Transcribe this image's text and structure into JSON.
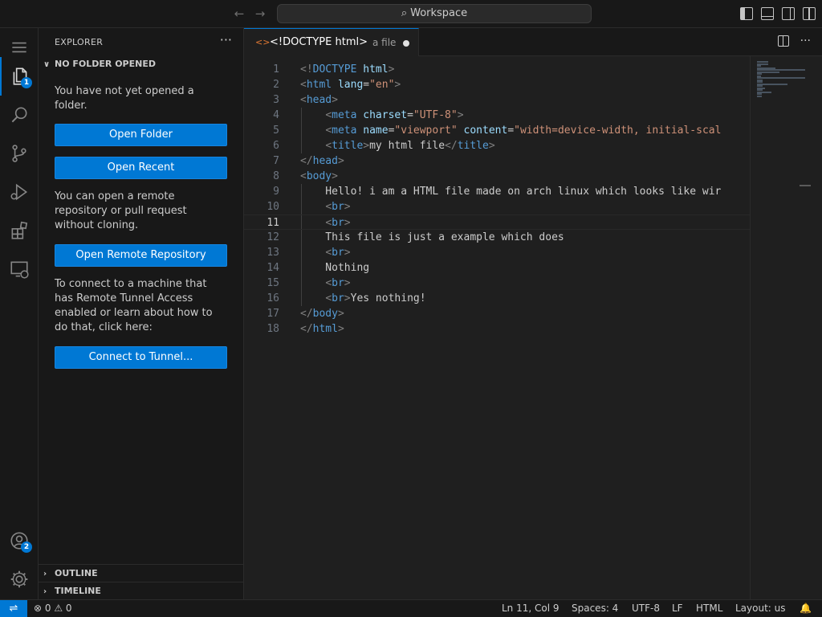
{
  "titlebar": {
    "back_icon": "arrow-left-icon",
    "forward_icon": "arrow-right-icon",
    "search_text": "Workspace"
  },
  "activity": {
    "explorer_badge": "1",
    "accounts_badge": "2"
  },
  "sidebar": {
    "title": "EXPLORER",
    "more": "···",
    "section_title": "NO FOLDER OPENED",
    "text1": "You have not yet opened a folder.",
    "btn_open_folder": "Open Folder",
    "btn_open_recent": "Open Recent",
    "text2": "You can open a remote repository or pull request without cloning.",
    "btn_open_remote": "Open Remote Repository",
    "text3": "To connect to a machine that has Remote Tunnel Access enabled or learn about how to do that, click here:",
    "btn_tunnel": "Connect to Tunnel...",
    "outline": "OUTLINE",
    "timeline": "TIMELINE"
  },
  "editor": {
    "tab_icon": "<>",
    "tab_name": "<!DOCTYPE html>",
    "tab_desc": "a file",
    "lines": [
      {
        "n": "1",
        "tokens": [
          [
            "br",
            "<!"
          ],
          [
            "tag",
            "DOCTYPE"
          ],
          [
            "txt",
            " "
          ],
          [
            "attr",
            "html"
          ],
          [
            "br",
            ">"
          ]
        ]
      },
      {
        "n": "2",
        "tokens": [
          [
            "br",
            "<"
          ],
          [
            "tag",
            "html"
          ],
          [
            "txt",
            " "
          ],
          [
            "attr",
            "lang"
          ],
          [
            "txt",
            "="
          ],
          [
            "str",
            "\"en\""
          ],
          [
            "br",
            ">"
          ]
        ]
      },
      {
        "n": "3",
        "tokens": [
          [
            "br",
            "<"
          ],
          [
            "tag",
            "head"
          ],
          [
            "br",
            ">"
          ]
        ]
      },
      {
        "n": "4",
        "tokens": [
          [
            "txt",
            "    "
          ],
          [
            "br",
            "<"
          ],
          [
            "tag",
            "meta"
          ],
          [
            "txt",
            " "
          ],
          [
            "attr",
            "charset"
          ],
          [
            "txt",
            "="
          ],
          [
            "str",
            "\"UTF-8\""
          ],
          [
            "br",
            ">"
          ]
        ]
      },
      {
        "n": "5",
        "tokens": [
          [
            "txt",
            "    "
          ],
          [
            "br",
            "<"
          ],
          [
            "tag",
            "meta"
          ],
          [
            "txt",
            " "
          ],
          [
            "attr",
            "name"
          ],
          [
            "txt",
            "="
          ],
          [
            "str",
            "\"viewport\""
          ],
          [
            "txt",
            " "
          ],
          [
            "attr",
            "content"
          ],
          [
            "txt",
            "="
          ],
          [
            "str",
            "\"width=device-width, initial-scal"
          ]
        ]
      },
      {
        "n": "6",
        "tokens": [
          [
            "txt",
            "    "
          ],
          [
            "br",
            "<"
          ],
          [
            "tag",
            "title"
          ],
          [
            "br",
            ">"
          ],
          [
            "txt",
            "my html file"
          ],
          [
            "br",
            "</"
          ],
          [
            "tag",
            "title"
          ],
          [
            "br",
            ">"
          ]
        ]
      },
      {
        "n": "7",
        "tokens": [
          [
            "br",
            "</"
          ],
          [
            "tag",
            "head"
          ],
          [
            "br",
            ">"
          ]
        ]
      },
      {
        "n": "8",
        "tokens": [
          [
            "br",
            "<"
          ],
          [
            "tag",
            "body"
          ],
          [
            "br",
            ">"
          ]
        ]
      },
      {
        "n": "9",
        "tokens": [
          [
            "txt",
            "    Hello! i am a HTML file made on arch linux which looks like wir"
          ]
        ]
      },
      {
        "n": "10",
        "tokens": [
          [
            "txt",
            "    "
          ],
          [
            "br",
            "<"
          ],
          [
            "tag",
            "br"
          ],
          [
            "br",
            ">"
          ]
        ]
      },
      {
        "n": "11",
        "tokens": [
          [
            "txt",
            "    "
          ],
          [
            "br",
            "<"
          ],
          [
            "tag",
            "br"
          ],
          [
            "br",
            ">"
          ]
        ]
      },
      {
        "n": "12",
        "tokens": [
          [
            "txt",
            "    This file is just a example which does"
          ]
        ]
      },
      {
        "n": "13",
        "tokens": [
          [
            "txt",
            "    "
          ],
          [
            "br",
            "<"
          ],
          [
            "tag",
            "br"
          ],
          [
            "br",
            ">"
          ]
        ]
      },
      {
        "n": "14",
        "tokens": [
          [
            "txt",
            "    Nothing"
          ]
        ]
      },
      {
        "n": "15",
        "tokens": [
          [
            "txt",
            "    "
          ],
          [
            "br",
            "<"
          ],
          [
            "tag",
            "br"
          ],
          [
            "br",
            ">"
          ]
        ]
      },
      {
        "n": "16",
        "tokens": [
          [
            "txt",
            "    "
          ],
          [
            "br",
            "<"
          ],
          [
            "tag",
            "br"
          ],
          [
            "br",
            ">"
          ],
          [
            "txt",
            "Yes nothing!"
          ]
        ]
      },
      {
        "n": "17",
        "tokens": [
          [
            "br",
            "</"
          ],
          [
            "tag",
            "body"
          ],
          [
            "br",
            ">"
          ]
        ]
      },
      {
        "n": "18",
        "tokens": [
          [
            "br",
            "</"
          ],
          [
            "tag",
            "html"
          ],
          [
            "br",
            ">"
          ]
        ]
      }
    ],
    "current_line": "11"
  },
  "statusbar": {
    "remote_icon": "remote-icon",
    "problems": "⊗ 0 ⚠ 0",
    "position": "Ln 11, Col 9",
    "spaces": "Spaces: 4",
    "encoding": "UTF-8",
    "eol": "LF",
    "language": "HTML",
    "layout": "Layout: us"
  },
  "colors": {
    "accent": "#0078d4",
    "background": "#1f1f1f",
    "panel": "#181818"
  }
}
